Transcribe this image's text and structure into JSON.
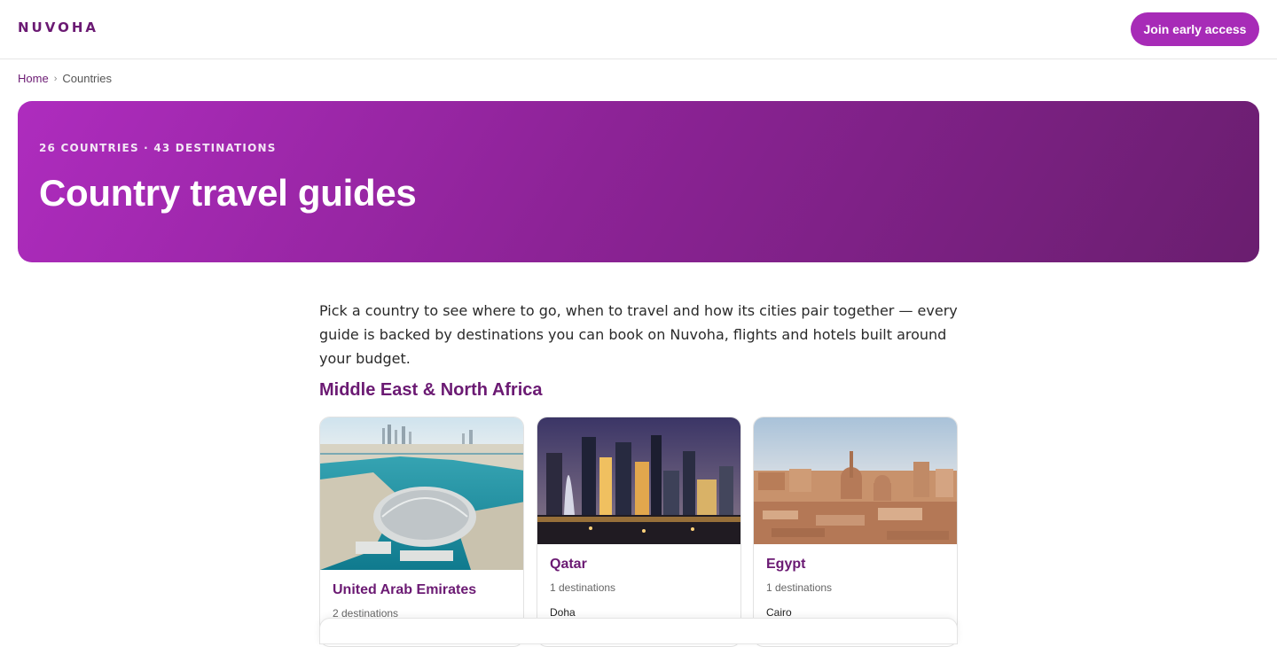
{
  "header": {
    "logo": "NUVOHA",
    "cta_label": "Join early access"
  },
  "breadcrumb": {
    "home": "Home",
    "separator": "›",
    "current": "Countries"
  },
  "hero": {
    "kicker": "26 COUNTRIES · 43 DESTINATIONS",
    "title": "Country travel guides"
  },
  "intro": "Pick a country to see where to go, when to travel and how its cities pair together — every guide is backed by destinations you can book on Nuvoha, flights and hotels built around your budget.",
  "section": {
    "title": "Middle East & North Africa",
    "cards": [
      {
        "name": "United Arab Emirates",
        "count": "2 destinations",
        "image": "abu-dhabi-louvre-aerial"
      },
      {
        "name": "Qatar",
        "count": "1 destinations",
        "city": "Doha",
        "image": "doha-skyline-night"
      },
      {
        "name": "Egypt",
        "count": "1 destinations",
        "city": "Cairo",
        "image": "cairo-old-city"
      }
    ]
  },
  "colors": {
    "brand": "#6b1a73",
    "accent": "#a72bb7",
    "hero_gradient_start": "#ae2cbe",
    "hero_gradient_end": "#6a1e6f"
  }
}
